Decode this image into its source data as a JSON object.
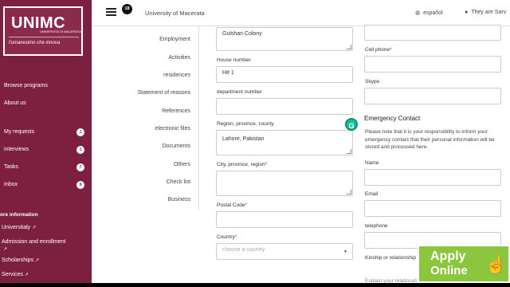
{
  "sidebar": {
    "logo_title": "UNIMC",
    "logo_subtitle": "UNIVERSITÀ DI MACERATA",
    "logo_motto": "l'umanesimo che innova",
    "items": [
      {
        "label": "Browse programs"
      },
      {
        "label": "About us"
      },
      {
        "label": "My requests",
        "badge": "1"
      },
      {
        "label": "interviews",
        "badge": "1"
      },
      {
        "label": "Tasks",
        "badge": "7"
      },
      {
        "label": "Inbox",
        "badge": "9"
      }
    ],
    "section_label": "ore information",
    "links": [
      {
        "label": "Universitaly"
      },
      {
        "label": "Admission and enrollment"
      },
      {
        "label": "Scholarships"
      },
      {
        "label": "Services"
      }
    ]
  },
  "topbar": {
    "notification_count": "18",
    "title": "University of Macerata",
    "language": "español",
    "user": "They are Sarv"
  },
  "submenu": [
    "Employment",
    "Activities",
    "residences",
    "Statement of reasons",
    "References",
    "electronic files",
    "Documents",
    "Others",
    "Check list",
    "Business"
  ],
  "form": {
    "address_value": "Gulshan  Colony",
    "house_number_label": "House number",
    "house_number_value": "H# 1",
    "department_label": "department number",
    "department_value": "",
    "region_label": "Region, province, county",
    "region_value": "Lahore, Pakistan",
    "city_label": "City, province, region",
    "city_value": "",
    "postal_label": "Postal Code",
    "postal_value": "",
    "country_label": "Country",
    "country_placeholder": "choose a country",
    "cellphone_label": "Cell phone",
    "skype_label": "Skype"
  },
  "emergency": {
    "title": "Emergency Contact",
    "note": "Please note that it is your responsibility to inform your emergency contact that their personal information will be stored and processed here.",
    "name_label": "Name",
    "email_label": "Email",
    "telephone_label": "telephone",
    "kinship_label": "Kinship or relationship",
    "explain_label": "Explain your relationship"
  },
  "apply": {
    "line1": "Apply",
    "line2": "Online"
  },
  "icons": {
    "grammarly": "G",
    "hand": "☝"
  },
  "colors": {
    "sidebar": "#7d1f3f",
    "apply": "#8cc63f",
    "required": "#c0392b",
    "grammarly": "#15c39a"
  }
}
